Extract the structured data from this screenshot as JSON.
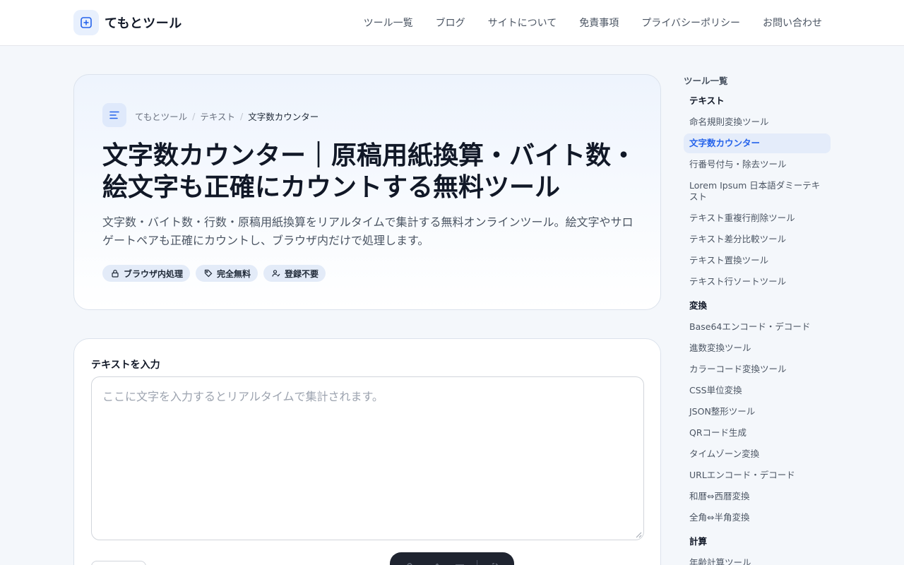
{
  "brand": {
    "name": "てもとツール"
  },
  "nav": {
    "items": [
      "ツール一覧",
      "ブログ",
      "サイトについて",
      "免責事項",
      "プライバシーポリシー",
      "お問い合わせ"
    ]
  },
  "hero": {
    "breadcrumb": [
      "てもとツール",
      "テキスト",
      "文字数カウンター"
    ],
    "title": "文字数カウンター｜原稿用紙換算・バイト数・絵文字も正確にカウントする無料ツール",
    "description": "文字数・バイト数・行数・原稿用紙換算をリアルタイムで集計する無料オンラインツール。絵文字やサロゲートペアも正確にカウントし、ブラウザ内だけで処理します。",
    "badges": [
      {
        "icon": "lock-icon",
        "label": "ブラウザ内処理"
      },
      {
        "icon": "tag-icon",
        "label": "完全無料"
      },
      {
        "icon": "user-check-icon",
        "label": "登録不要"
      }
    ]
  },
  "input": {
    "label": "テキストを入力",
    "value": "",
    "placeholder": "ここに文字を入力するとリアルタイムで集計されます。"
  },
  "sidebar": {
    "title": "ツール一覧",
    "categories": [
      {
        "name": "テキスト",
        "items": [
          "命名規則変換ツール",
          "文字数カウンター",
          "行番号付与・除去ツール",
          "Lorem Ipsum 日本語ダミーテキスト",
          "テキスト重複行削除ツール",
          "テキスト差分比較ツール",
          "テキスト置換ツール",
          "テキスト行ソートツール"
        ]
      },
      {
        "name": "変換",
        "items": [
          "Base64エンコード・デコード",
          "進数変換ツール",
          "カラーコード変換ツール",
          "CSS単位変換",
          "JSON整形ツール",
          "QRコード生成",
          "タイムゾーン変換",
          "URLエンコード・デコード",
          "和暦⇔西暦変換",
          "全角⇔半角変換"
        ]
      },
      {
        "name": "計算",
        "items": [
          "年齢計算ツール"
        ]
      }
    ],
    "active_item": "文字数カウンター"
  },
  "colors": {
    "accent": "#2563eb",
    "toolbar_bg": "#1f2430"
  }
}
